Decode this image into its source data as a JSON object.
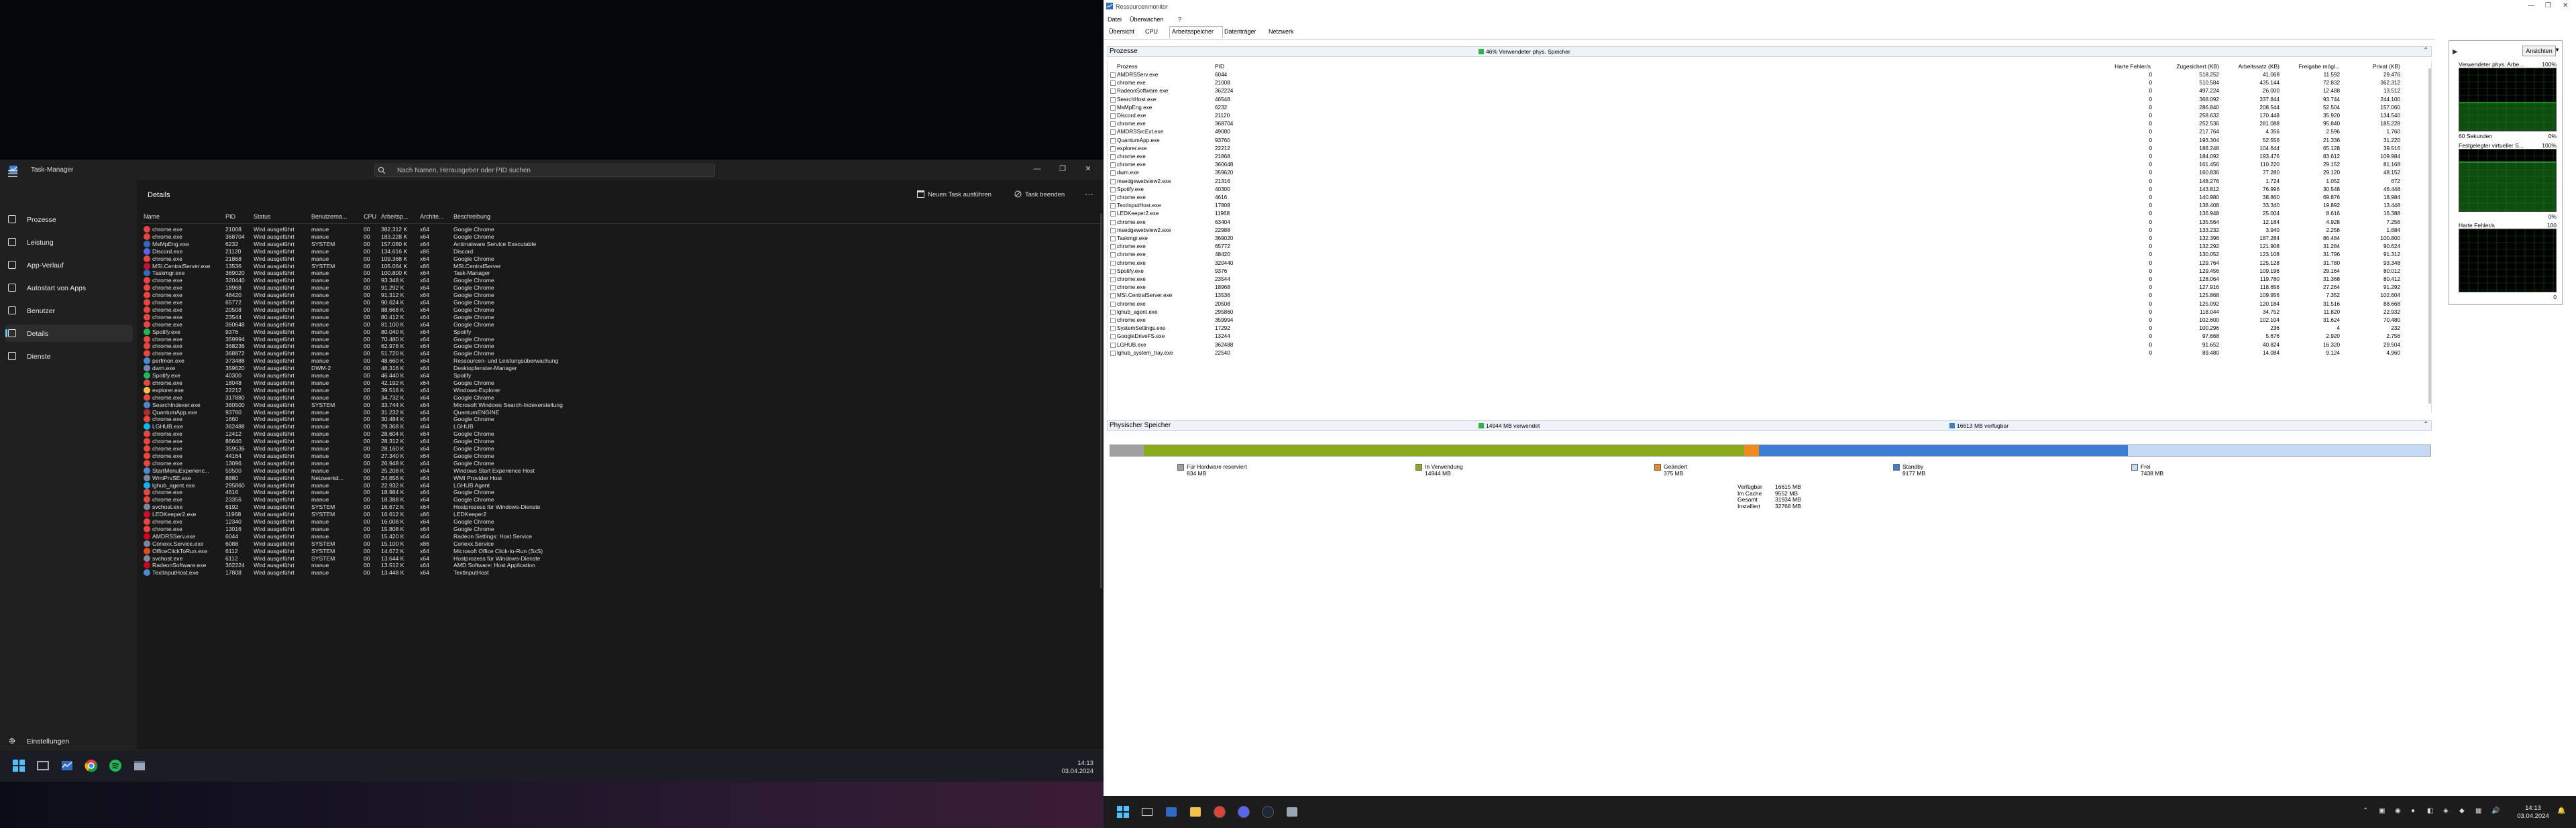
{
  "taskmanager": {
    "title": "Task-Manager",
    "search_placeholder": "Nach Namen, Herausgeber oder PID suchen",
    "heading": "Details",
    "new_task": "Neuen Task ausführen",
    "end_task": "Task beenden",
    "more": "···",
    "nav": [
      {
        "label": "Prozesse",
        "icon": "processes-icon"
      },
      {
        "label": "Leistung",
        "icon": "performance-icon"
      },
      {
        "label": "App-Verlauf",
        "icon": "app-history-icon"
      },
      {
        "label": "Autostart von Apps",
        "icon": "startup-apps-icon"
      },
      {
        "label": "Benutzer",
        "icon": "users-icon"
      },
      {
        "label": "Details",
        "icon": "details-icon"
      },
      {
        "label": "Dienste",
        "icon": "services-icon"
      }
    ],
    "settings": "Einstellungen",
    "columns": [
      "Name",
      "PID",
      "Status",
      "Benutzerna...",
      "CPU",
      "Arbeitsp...",
      "Archite...",
      "Beschreibung"
    ],
    "rows": [
      [
        "chrome.exe",
        "21008",
        "Wird ausgeführt",
        "manue",
        "00",
        "382.312 K",
        "x64",
        "Google Chrome",
        "chrome"
      ],
      [
        "chrome.exe",
        "368704",
        "Wird ausgeführt",
        "manue",
        "00",
        "183.228 K",
        "x64",
        "Google Chrome",
        "chrome"
      ],
      [
        "MsMpEng.exe",
        "6232",
        "Wird ausgeführt",
        "SYSTEM",
        "00",
        "157.060 K",
        "x64",
        "Antimalware Service Executable",
        "shield"
      ],
      [
        "Discord.exe",
        "21120",
        "Wird ausgeführt",
        "manue",
        "00",
        "134.616 K",
        "x86",
        "Discord",
        "discord"
      ],
      [
        "chrome.exe",
        "21868",
        "Wird ausgeführt",
        "manue",
        "00",
        "109.368 K",
        "x64",
        "Google Chrome",
        "chrome"
      ],
      [
        "MSI.CentralServer.exe",
        "13536",
        "Wird ausgeführt",
        "SYSTEM",
        "00",
        "105.064 K",
        "x86",
        "MSI.CentralServer",
        "msi"
      ],
      [
        "Taskmgr.exe",
        "369020",
        "Wird ausgeführt",
        "manue",
        "00",
        "100.800 K",
        "x64",
        "Task-Manager",
        "taskmgr"
      ],
      [
        "chrome.exe",
        "320440",
        "Wird ausgeführt",
        "manue",
        "00",
        "93.348 K",
        "x64",
        "Google Chrome",
        "chrome"
      ],
      [
        "chrome.exe",
        "18968",
        "Wird ausgeführt",
        "manue",
        "00",
        "91.292 K",
        "x64",
        "Google Chrome",
        "chrome"
      ],
      [
        "chrome.exe",
        "48420",
        "Wird ausgeführt",
        "manue",
        "00",
        "91.312 K",
        "x64",
        "Google Chrome",
        "chrome"
      ],
      [
        "chrome.exe",
        "65772",
        "Wird ausgeführt",
        "manue",
        "00",
        "90.624 K",
        "x64",
        "Google Chrome",
        "chrome"
      ],
      [
        "chrome.exe",
        "20508",
        "Wird ausgeführt",
        "manue",
        "00",
        "88.668 K",
        "x64",
        "Google Chrome",
        "chrome"
      ],
      [
        "chrome.exe",
        "23544",
        "Wird ausgeführt",
        "manue",
        "00",
        "80.412 K",
        "x64",
        "Google Chrome",
        "chrome"
      ],
      [
        "chrome.exe",
        "360648",
        "Wird ausgeführt",
        "manue",
        "00",
        "81.100 K",
        "x64",
        "Google Chrome",
        "chrome"
      ],
      [
        "Spotify.exe",
        "9376",
        "Wird ausgeführt",
        "manue",
        "00",
        "80.040 K",
        "x64",
        "Spotify",
        "spotify"
      ],
      [
        "chrome.exe",
        "359994",
        "Wird ausgeführt",
        "manue",
        "00",
        "70.480 K",
        "x64",
        "Google Chrome",
        "chrome"
      ],
      [
        "chrome.exe",
        "368236",
        "Wird ausgeführt",
        "manue",
        "00",
        "62.976 K",
        "x64",
        "Google Chrome",
        "chrome"
      ],
      [
        "chrome.exe",
        "368872",
        "Wird ausgeführt",
        "manue",
        "00",
        "51.720 K",
        "x64",
        "Google Chrome",
        "chrome"
      ],
      [
        "perfmon.exe",
        "373488",
        "Wird ausgeführt",
        "manue",
        "00",
        "48.660 K",
        "x64",
        "Ressourcen- und Leistungsüberwachung",
        "perfmon"
      ],
      [
        "dwm.exe",
        "359620",
        "Wird ausgeführt",
        "DWM-2",
        "00",
        "48.316 K",
        "x64",
        "Desktopfenster-Manager",
        "dwm"
      ],
      [
        "Spotify.exe",
        "40300",
        "Wird ausgeführt",
        "manue",
        "00",
        "46.440 K",
        "x64",
        "Spotify",
        "spotify"
      ],
      [
        "chrome.exe",
        "18048",
        "Wird ausgeführt",
        "manue",
        "00",
        "42.192 K",
        "x64",
        "Google Chrome",
        "chrome"
      ],
      [
        "explorer.exe",
        "22212",
        "Wird ausgeführt",
        "manue",
        "00",
        "39.516 K",
        "x64",
        "Windows-Explorer",
        "explorer"
      ],
      [
        "chrome.exe",
        "317880",
        "Wird ausgeführt",
        "manue",
        "00",
        "34.732 K",
        "x64",
        "Google Chrome",
        "chrome"
      ],
      [
        "SearchIndexer.exe",
        "360500",
        "Wird ausgeführt",
        "SYSTEM",
        "00",
        "33.744 K",
        "x64",
        "Microsoft Windows Search-Indexerstellung",
        "search"
      ],
      [
        "QuantumApp.exe",
        "93760",
        "Wird ausgeführt",
        "manue",
        "00",
        "31.232 K",
        "x64",
        "QuantumENGINE",
        "quantum"
      ],
      [
        "chrome.exe",
        "1660",
        "Wird ausgeführt",
        "manue",
        "00",
        "30.484 K",
        "x64",
        "Google Chrome",
        "chrome"
      ],
      [
        "LGHUB.exe",
        "362488",
        "Wird ausgeführt",
        "manue",
        "00",
        "29.368 K",
        "x64",
        "LGHUB",
        "lghub"
      ],
      [
        "chrome.exe",
        "12412",
        "Wird ausgeführt",
        "manue",
        "00",
        "28.604 K",
        "x64",
        "Google Chrome",
        "chrome"
      ],
      [
        "chrome.exe",
        "86640",
        "Wird ausgeführt",
        "manue",
        "00",
        "28.312 K",
        "x64",
        "Google Chrome",
        "chrome"
      ],
      [
        "chrome.exe",
        "359536",
        "Wird ausgeführt",
        "manue",
        "00",
        "28.160 K",
        "x64",
        "Google Chrome",
        "chrome"
      ],
      [
        "chrome.exe",
        "44164",
        "Wird ausgeführt",
        "manue",
        "00",
        "27.340 K",
        "x64",
        "Google Chrome",
        "chrome"
      ],
      [
        "chrome.exe",
        "13096",
        "Wird ausgeführt",
        "manue",
        "00",
        "26.948 K",
        "x64",
        "Google Chrome",
        "chrome"
      ],
      [
        "StartMenuExperienc...",
        "59500",
        "Wird ausgeführt",
        "manue",
        "00",
        "25.208 K",
        "x64",
        "Windows Start Experience Host",
        "startmenu"
      ],
      [
        "WmiPrvSE.exe",
        "8880",
        "Wird ausgeführt",
        "Netzwerkd...",
        "00",
        "24.656 K",
        "x64",
        "WMI Provider Host",
        "wmi"
      ],
      [
        "lghub_agent.exe",
        "295860",
        "Wird ausgeführt",
        "manue",
        "00",
        "22.932 K",
        "x64",
        "LGHUB Agent",
        "lghub"
      ],
      [
        "chrome.exe",
        "4616",
        "Wird ausgeführt",
        "manue",
        "00",
        "18.984 K",
        "x64",
        "Google Chrome",
        "chrome"
      ],
      [
        "chrome.exe",
        "23356",
        "Wird ausgeführt",
        "manue",
        "00",
        "18.388 K",
        "x64",
        "Google Chrome",
        "chrome"
      ],
      [
        "svchost.exe",
        "6192",
        "Wird ausgeführt",
        "SYSTEM",
        "00",
        "16.672 K",
        "x64",
        "Hostprozess für Windows-Dienste",
        "svchost"
      ],
      [
        "LEDKeeper2.exe",
        "11968",
        "Wird ausgeführt",
        "SYSTEM",
        "00",
        "16.612 K",
        "x86",
        "LEDKeeper2",
        "led"
      ],
      [
        "chrome.exe",
        "12340",
        "Wird ausgeführt",
        "manue",
        "00",
        "16.008 K",
        "x64",
        "Google Chrome",
        "chrome"
      ],
      [
        "chrome.exe",
        "13016",
        "Wird ausgeführt",
        "manue",
        "00",
        "15.808 K",
        "x64",
        "Google Chrome",
        "chrome"
      ],
      [
        "AMDRSServ.exe",
        "6044",
        "Wird ausgeführt",
        "manue",
        "00",
        "15.420 K",
        "x64",
        "Radeon Settings: Host Service",
        "amd"
      ],
      [
        "Conexx.Service.exe",
        "6088",
        "Wird ausgeführt",
        "SYSTEM",
        "00",
        "15.100 K",
        "x86",
        "Conexx.Service",
        "conexx"
      ],
      [
        "OfficeClickToRun.exe",
        "6112",
        "Wird ausgeführt",
        "SYSTEM",
        "00",
        "14.672 K",
        "x64",
        "Microsoft Office Click-to-Run (SxS)",
        "office"
      ],
      [
        "svchost.exe",
        "6112",
        "Wird ausgeführt",
        "SYSTEM",
        "00",
        "13.644 K",
        "x64",
        "Hostprozess für Windows-Dienste",
        "svchost"
      ],
      [
        "RadeonSoftware.exe",
        "362224",
        "Wird ausgeführt",
        "manue",
        "00",
        "13.512 K",
        "x64",
        "AMD Software: Host Application",
        "amd"
      ],
      [
        "TextInputHost.exe",
        "17808",
        "Wird ausgeführt",
        "manue",
        "00",
        "13.448 K",
        "x64",
        "TextInputHost",
        "textinput"
      ]
    ]
  },
  "left_taskbar": {
    "time": "14:13",
    "date": "03.04.2024"
  },
  "resmon": {
    "title": "Ressourcenmonitor",
    "menu": [
      "Datei",
      "Überwachen",
      "?"
    ],
    "tabs": [
      "Übersicht",
      "CPU",
      "Arbeitsspeicher",
      "Datenträger",
      "Netzwerk"
    ],
    "active_tab": "Arbeitsspeicher",
    "processes": {
      "title": "Prozesse",
      "status": "46% Verwendeter phys. Speicher",
      "columns": [
        "Prozess",
        "PID",
        "Harte Fehler/s",
        "Zugesichert (KB)",
        "Arbeitssatz (KB)",
        "Freigabe mögl...",
        "Privat (KB)"
      ],
      "rows": [
        [
          "AMDRSServ.exe",
          "6044",
          "0",
          "518.252",
          "41.068",
          "11.592",
          "29.476"
        ],
        [
          "chrome.exe",
          "21008",
          "0",
          "510.584",
          "435.144",
          "72.832",
          "362.312"
        ],
        [
          "RadeonSoftware.exe",
          "362224",
          "0",
          "497.224",
          "26.000",
          "12.488",
          "13.512"
        ],
        [
          "SearchHost.exe",
          "46548",
          "0",
          "368.092",
          "337.844",
          "93.744",
          "244.100"
        ],
        [
          "MsMpEng.exe",
          "6232",
          "0",
          "286.840",
          "208.544",
          "52.504",
          "157.060"
        ],
        [
          "Discord.exe",
          "21120",
          "0",
          "258.632",
          "170.448",
          "35.920",
          "134.540"
        ],
        [
          "chrome.exe",
          "368704",
          "0",
          "252.536",
          "281.088",
          "95.840",
          "185.228"
        ],
        [
          "AMDRSSrcExt.exe",
          "49080",
          "0",
          "217.764",
          "4.356",
          "2.596",
          "1.760"
        ],
        [
          "QuantumApp.exe",
          "93760",
          "0",
          "193.304",
          "52.556",
          "21.336",
          "31.220"
        ],
        [
          "explorer.exe",
          "22212",
          "0",
          "188.248",
          "104.644",
          "65.128",
          "39.516"
        ],
        [
          "chrome.exe",
          "21868",
          "0",
          "184.092",
          "193.476",
          "83.612",
          "109.984"
        ],
        [
          "chrome.exe",
          "360648",
          "0",
          "161.456",
          "110.220",
          "29.152",
          "81.168"
        ],
        [
          "dwm.exe",
          "359620",
          "0",
          "160.836",
          "77.280",
          "29.120",
          "48.152"
        ],
        [
          "msedgewebview2.exe",
          "21316",
          "0",
          "148.276",
          "1.724",
          "1.052",
          "672"
        ],
        [
          "Spotify.exe",
          "40300",
          "0",
          "143.812",
          "76.996",
          "30.548",
          "46.448"
        ],
        [
          "chrome.exe",
          "4616",
          "0",
          "140.980",
          "38.860",
          "69.876",
          "18.984"
        ],
        [
          "TextInputHost.exe",
          "17808",
          "0",
          "138.408",
          "33.340",
          "19.892",
          "13.448"
        ],
        [
          "LEDKeeper2.exe",
          "11968",
          "0",
          "136.948",
          "25.004",
          "8.616",
          "16.388"
        ],
        [
          "chrome.exe",
          "63404",
          "0",
          "135.564",
          "12.184",
          "4.928",
          "7.256"
        ],
        [
          "msedgewebview2.exe",
          "22988",
          "0",
          "133.232",
          "3.940",
          "2.256",
          "1.684"
        ],
        [
          "Taskmgr.exe",
          "369020",
          "0",
          "132.396",
          "187.284",
          "86.484",
          "100.800"
        ],
        [
          "chrome.exe",
          "65772",
          "0",
          "132.292",
          "121.908",
          "31.284",
          "90.624"
        ],
        [
          "chrome.exe",
          "48420",
          "0",
          "130.052",
          "123.108",
          "31.796",
          "91.312"
        ],
        [
          "chrome.exe",
          "320440",
          "0",
          "129.764",
          "125.128",
          "31.780",
          "93.348"
        ],
        [
          "Spotify.exe",
          "9376",
          "0",
          "129.456",
          "109.196",
          "29.164",
          "80.012"
        ],
        [
          "chrome.exe",
          "23544",
          "0",
          "128.064",
          "119.780",
          "31.368",
          "80.412"
        ],
        [
          "chrome.exe",
          "18968",
          "0",
          "127.916",
          "118.656",
          "27.264",
          "91.292"
        ],
        [
          "MSI.CentralServer.exe",
          "13536",
          "0",
          "125.868",
          "109.956",
          "7.352",
          "102.604"
        ],
        [
          "chrome.exe",
          "20508",
          "0",
          "125.092",
          "120.184",
          "31.516",
          "88.668"
        ],
        [
          "lghub_agent.exe",
          "295860",
          "0",
          "118.044",
          "34.752",
          "11.820",
          "22.932"
        ],
        [
          "chrome.exe",
          "359994",
          "0",
          "102.600",
          "102.104",
          "31.624",
          "70.480"
        ],
        [
          "SystemSettings.exe",
          "17292",
          "0",
          "100.296",
          "236",
          "4",
          "232"
        ],
        [
          "GoogleDriveFS.exe",
          "13244",
          "0",
          "97.668",
          "5.676",
          "2.920",
          "2.756"
        ],
        [
          "LGHUB.exe",
          "362488",
          "0",
          "91.652",
          "40.824",
          "16.320",
          "29.504"
        ],
        [
          "lghub_system_tray.exe",
          "22540",
          "0",
          "89.480",
          "14.084",
          "9.124",
          "4.960"
        ]
      ]
    },
    "memory": {
      "title": "Physischer Speicher",
      "in_use": "14944 MB verwendet",
      "available": "16613 MB verfügbar",
      "legend": [
        {
          "label": "Für Hardware reserviert",
          "value": "834 MB",
          "color": "#a0a0a0"
        },
        {
          "label": "In Verwendung",
          "value": "14944 MB",
          "color": "#8aa91b"
        },
        {
          "label": "Geändert",
          "value": "375 MB",
          "color": "#f08b1a"
        },
        {
          "label": "Standby",
          "value": "9177 MB",
          "color": "#3a7fd3"
        },
        {
          "label": "Frei",
          "value": "7438 MB",
          "color": "#c5dbf5"
        }
      ],
      "fractions": [
        0.0255,
        0.4546,
        0.0114,
        0.2792,
        0.2293
      ],
      "stats": [
        {
          "label": "Verfügbar",
          "value": "16615 MB"
        },
        {
          "label": "Im Cache",
          "value": "9552 MB"
        },
        {
          "label": "Gesamt",
          "value": "31934 MB"
        },
        {
          "label": "Installiert",
          "value": "32768 MB"
        }
      ]
    },
    "graphs": {
      "view_label": "Ansichten",
      "items": [
        {
          "title": "Verwendeter phys. Arbe...",
          "top": "100%",
          "bottom_label": "60 Sekunden",
          "bottom": "0%",
          "level": 0.46
        },
        {
          "title": "Festgelegter virtueller S...",
          "top": "100%",
          "bottom_label": "",
          "bottom": "0%",
          "level": 0.8
        },
        {
          "title": "Harte Fehler/s",
          "top": "100",
          "bottom_label": "",
          "bottom": "0",
          "level": 0.0
        }
      ]
    }
  },
  "right_taskbar": {
    "time": "14:13",
    "date": "03.04.2024"
  }
}
